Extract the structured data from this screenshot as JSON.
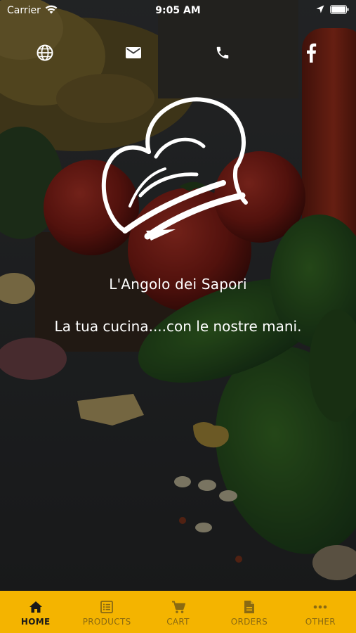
{
  "status_bar": {
    "carrier": "Carrier",
    "time": "9:05 AM",
    "icons": [
      "wifi-icon",
      "location-arrow-icon",
      "battery-icon"
    ]
  },
  "top_actions": [
    {
      "name": "website",
      "icon": "globe-icon"
    },
    {
      "name": "email",
      "icon": "mail-icon"
    },
    {
      "name": "phone",
      "icon": "phone-icon"
    },
    {
      "name": "facebook",
      "icon": "facebook-icon"
    }
  ],
  "hero": {
    "logo": "chef-hat-logo",
    "brand_name": "L'Angolo dei Sapori",
    "tagline": "La tua cucina....con le nostre mani."
  },
  "tab_bar": {
    "background_color": "#f4b400",
    "active_color": "#1a1a1a",
    "inactive_color": "#8a6a12",
    "tabs": [
      {
        "label": "HOME",
        "icon": "home-icon",
        "active": true
      },
      {
        "label": "PRODUCTS",
        "icon": "list-icon",
        "active": false
      },
      {
        "label": "CART",
        "icon": "cart-icon",
        "active": false
      },
      {
        "label": "ORDERS",
        "icon": "document-icon",
        "active": false
      },
      {
        "label": "OTHER",
        "icon": "more-icon",
        "active": false
      }
    ]
  }
}
